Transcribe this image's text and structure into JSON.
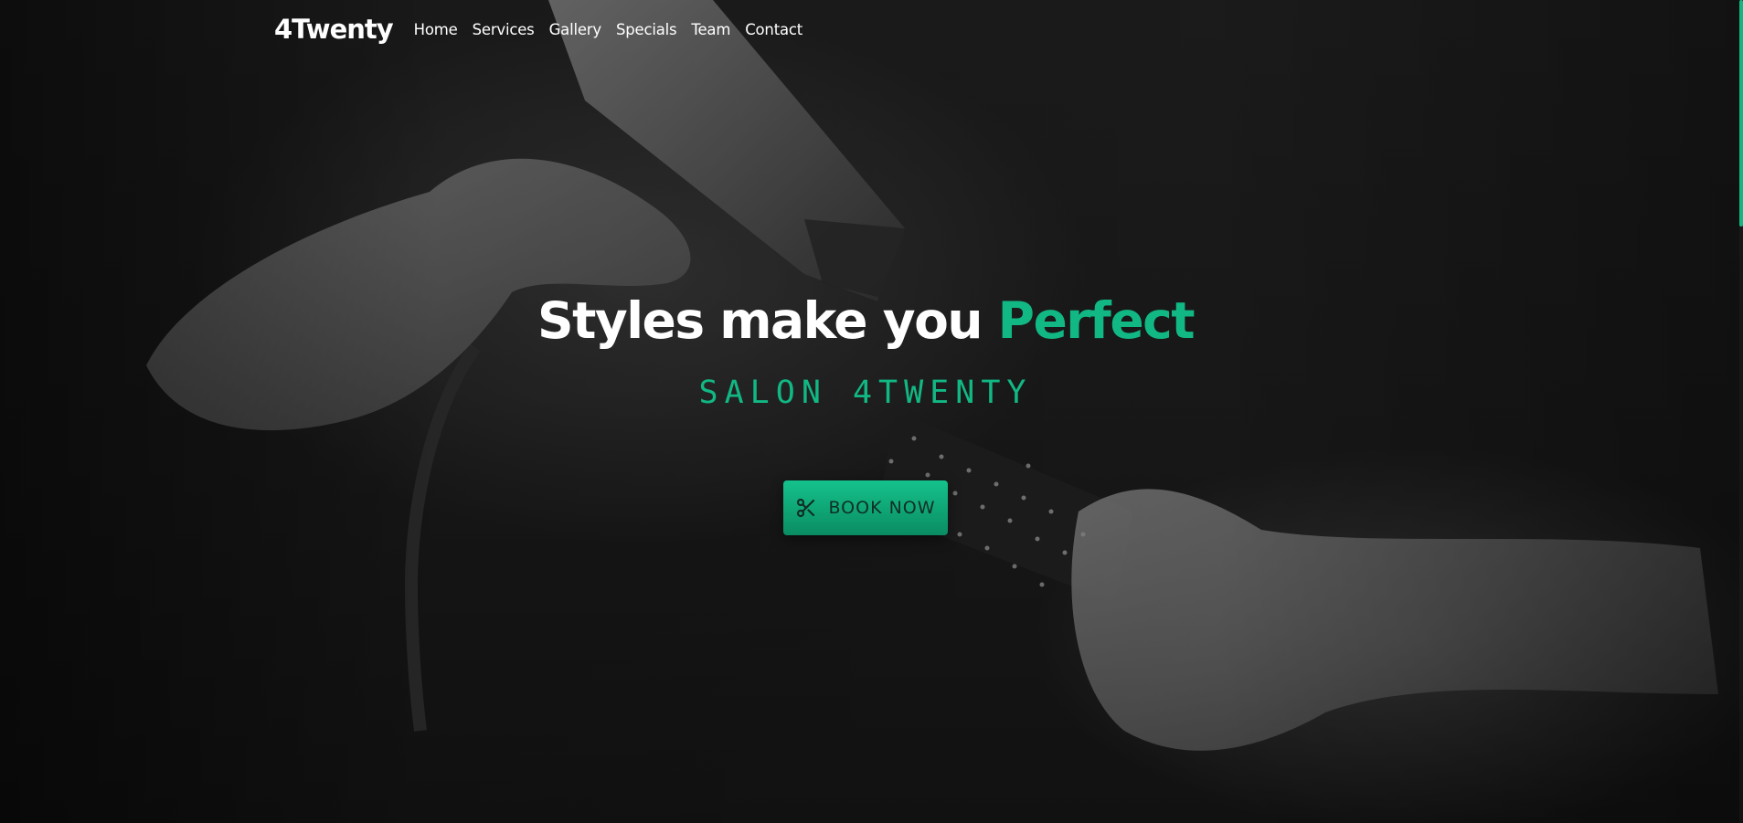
{
  "header": {
    "logo": "4Twenty",
    "nav": [
      {
        "label": "Home"
      },
      {
        "label": "Services"
      },
      {
        "label": "Gallery"
      },
      {
        "label": "Specials"
      },
      {
        "label": "Team"
      },
      {
        "label": "Contact"
      }
    ]
  },
  "hero": {
    "headline_main": "Styles make you ",
    "headline_accent": "Perfect",
    "subtitle": "SALON 4TWENTY",
    "cta_label": "BOOK NOW",
    "cta_icon": "scissors-icon",
    "background_image": "hair-dryer-and-brush-photo"
  },
  "colors": {
    "accent": "#12b884",
    "background": "#141414",
    "text": "#ffffff"
  }
}
